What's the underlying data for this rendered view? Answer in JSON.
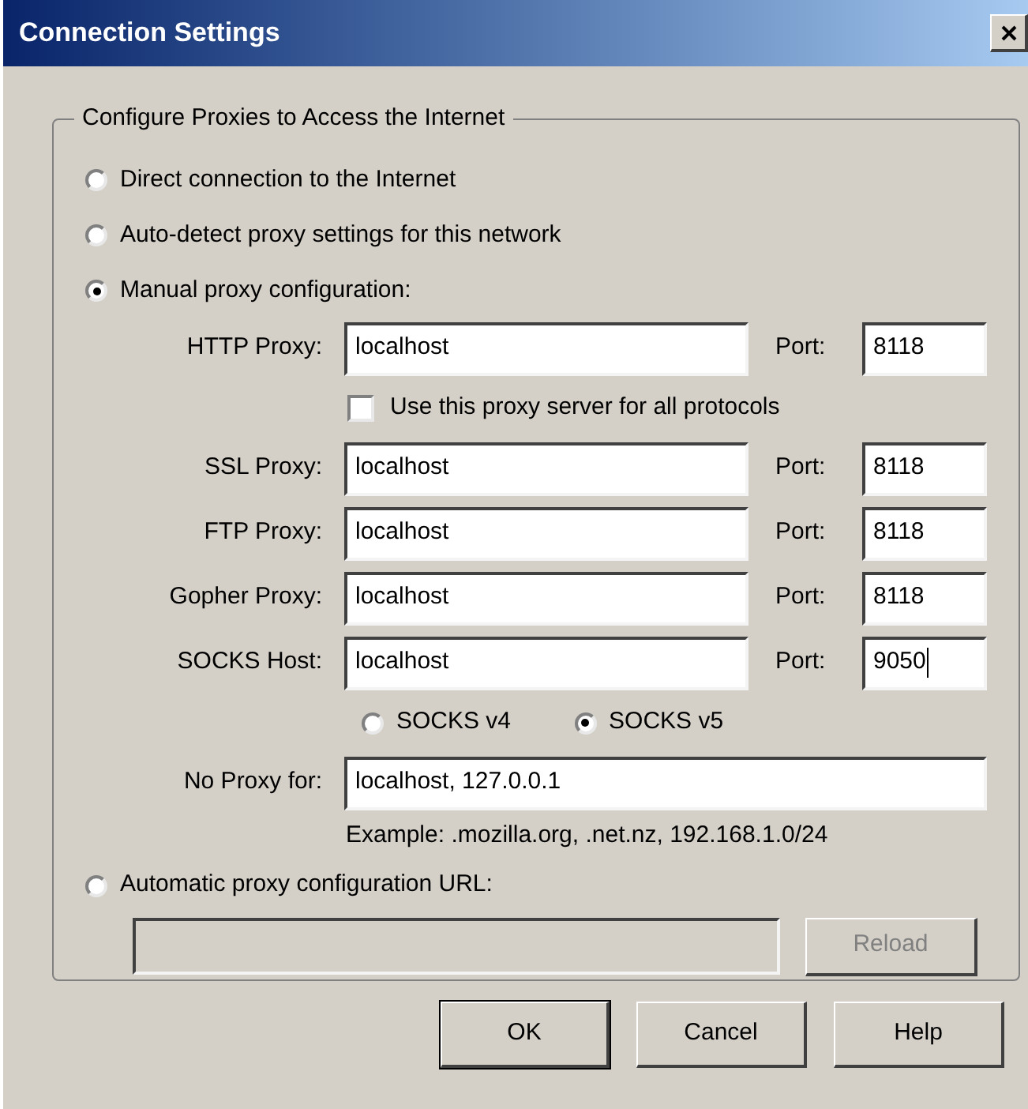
{
  "window": {
    "title": "Connection Settings"
  },
  "group": {
    "legend": "Configure Proxies to Access the Internet"
  },
  "modes": [
    {
      "label": "Direct connection to the Internet",
      "selected": false
    },
    {
      "label": "Auto-detect proxy settings for this network",
      "selected": false
    },
    {
      "label": "Manual proxy configuration:",
      "selected": true
    }
  ],
  "http_proxy": {
    "label": "HTTP Proxy:",
    "value": "localhost",
    "port_label": "Port:",
    "port": "8118",
    "caret": false
  },
  "share_proxy": {
    "label": "Use this proxy server for all protocols",
    "checked": false
  },
  "proxies": [
    {
      "label": "SSL Proxy:",
      "value": "localhost",
      "port_label": "Port:",
      "port": "8118",
      "caret": false
    },
    {
      "label": "FTP Proxy:",
      "value": "localhost",
      "port_label": "Port:",
      "port": "8118",
      "caret": false
    },
    {
      "label": "Gopher Proxy:",
      "value": "localhost",
      "port_label": "Port:",
      "port": "8118",
      "caret": false
    },
    {
      "label": "SOCKS Host:",
      "value": "localhost",
      "port_label": "Port:",
      "port": "9050",
      "caret": true
    }
  ],
  "socks_versions": [
    {
      "label": "SOCKS v4",
      "selected": false
    },
    {
      "label": "SOCKS v5",
      "selected": true
    }
  ],
  "no_proxy": {
    "label": "No Proxy for:",
    "value": "localhost, 127.0.0.1",
    "example": "Example: .mozilla.org, .net.nz, 192.168.1.0/24"
  },
  "auto_config": {
    "label": "Automatic proxy configuration URL:",
    "selected": false,
    "disabled": true,
    "reload": {
      "label": "Reload",
      "disabled": true
    }
  },
  "buttons": [
    {
      "label": "OK"
    },
    {
      "label": "Cancel"
    },
    {
      "label": "Help"
    }
  ]
}
